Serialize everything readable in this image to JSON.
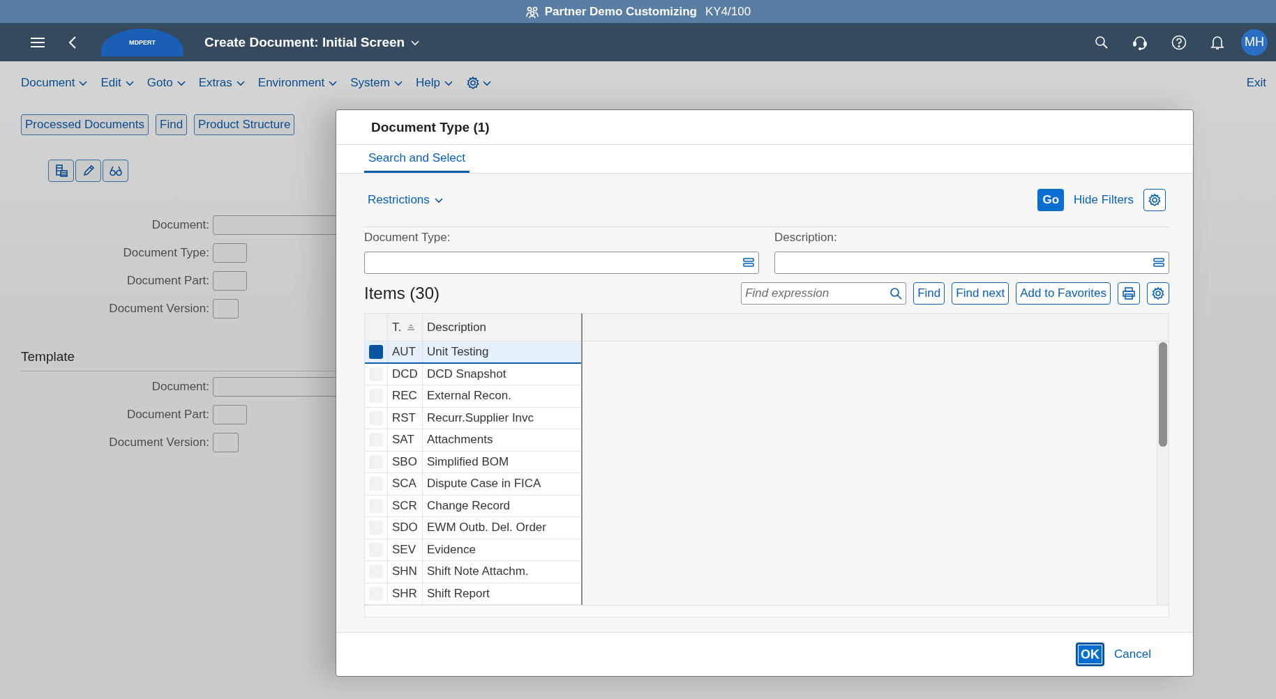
{
  "title_bar": {
    "title": "Partner Demo Customizing",
    "system": "KY4/100"
  },
  "shell_bar": {
    "logo": "MDPERT",
    "title": "Create Document: Initial Screen",
    "avatar": "MH"
  },
  "menu": {
    "items": [
      {
        "label": "Document"
      },
      {
        "label": "Edit"
      },
      {
        "label": "Goto"
      },
      {
        "label": "Extras"
      },
      {
        "label": "Environment"
      },
      {
        "label": "System"
      },
      {
        "label": "Help"
      }
    ],
    "exit": "Exit"
  },
  "toolbar": {
    "buttons": [
      "Processed Documents",
      "Find",
      "Product Structure"
    ]
  },
  "form": {
    "fields": [
      {
        "label": "Document:",
        "kind": "wide"
      },
      {
        "label": "Document Type:",
        "kind": "short"
      },
      {
        "label": "Document Part:",
        "kind": "short"
      },
      {
        "label": "Document Version:",
        "kind": "tiny"
      }
    ]
  },
  "template": {
    "title": "Template",
    "fields": [
      {
        "label": "Document:",
        "kind": "wide"
      },
      {
        "label": "Document Part:",
        "kind": "short"
      },
      {
        "label": "Document Version:",
        "kind": "tiny"
      }
    ]
  },
  "dialog": {
    "title": "Document Type (1)",
    "tabs": [
      {
        "label": "Search and Select",
        "selected": true
      }
    ],
    "restrictions": "Restrictions",
    "go": "Go",
    "hide_filters": "Hide Filters",
    "filters": [
      {
        "label": "Document Type:"
      },
      {
        "label": "Description:"
      }
    ],
    "items_title": "Items (30)",
    "find_placeholder": "Find expression",
    "buttons": [
      "Find",
      "Find next",
      "Add to Favorites"
    ],
    "table": {
      "columns": [
        "T.",
        "Description"
      ],
      "rows": [
        {
          "code": "AUT",
          "description": "Unit Testing",
          "selected": true
        },
        {
          "code": "DCD",
          "description": "DCD Snapshot",
          "selected": false
        },
        {
          "code": "REC",
          "description": "External Recon.",
          "selected": false
        },
        {
          "code": "RST",
          "description": "Recurr.Supplier Invc",
          "selected": false
        },
        {
          "code": "SAT",
          "description": "Attachments",
          "selected": false
        },
        {
          "code": "SBO",
          "description": "Simplified BOM",
          "selected": false
        },
        {
          "code": "SCA",
          "description": "Dispute Case in FICA",
          "selected": false
        },
        {
          "code": "SCR",
          "description": "Change Record",
          "selected": false
        },
        {
          "code": "SDO",
          "description": "EWM Outb. Del. Order",
          "selected": false
        },
        {
          "code": "SEV",
          "description": "Evidence",
          "selected": false
        },
        {
          "code": "SHN",
          "description": "Shift Note Attachm.",
          "selected": false
        },
        {
          "code": "SHR",
          "description": "Shift Report",
          "selected": false
        }
      ]
    },
    "footer": {
      "ok": "OK",
      "cancel": "Cancel"
    }
  }
}
